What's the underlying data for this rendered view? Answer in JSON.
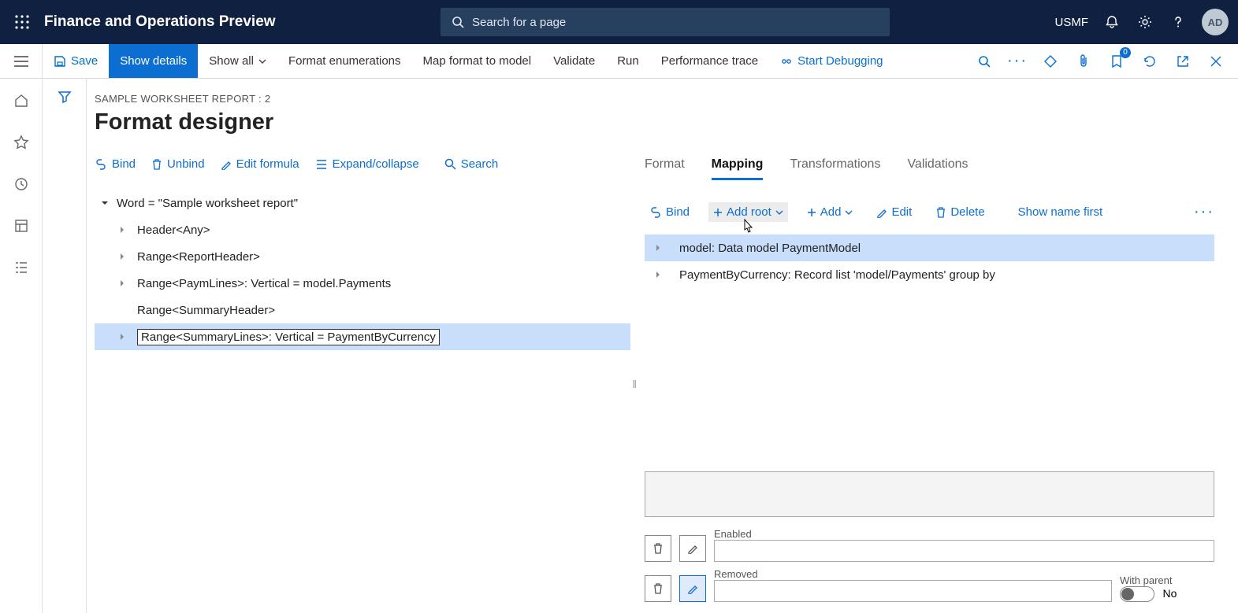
{
  "header": {
    "app_title": "Finance and Operations Preview",
    "search_placeholder": "Search for a page",
    "entity": "USMF",
    "avatar": "AD"
  },
  "cmdbar": {
    "save": "Save",
    "show_details": "Show details",
    "show_all": "Show all",
    "format_enum": "Format enumerations",
    "map_format": "Map format to model",
    "validate": "Validate",
    "run": "Run",
    "perf_trace": "Performance trace",
    "start_debug": "Start Debugging",
    "badge_count": "0"
  },
  "page": {
    "breadcrumb": "SAMPLE WORKSHEET REPORT : 2",
    "title": "Format designer"
  },
  "left_toolbar": {
    "bind": "Bind",
    "unbind": "Unbind",
    "edit_formula": "Edit formula",
    "expand_collapse": "Expand/collapse",
    "search": "Search"
  },
  "format_tree": {
    "root": "Word = \"Sample worksheet report\"",
    "items": [
      "Header<Any>",
      "Range<ReportHeader>",
      "Range<PaymLines>: Vertical = model.Payments",
      "Range<SummaryHeader>",
      "Range<SummaryLines>: Vertical = PaymentByCurrency"
    ]
  },
  "tabs": {
    "format": "Format",
    "mapping": "Mapping",
    "transformations": "Transformations",
    "validations": "Validations"
  },
  "right_toolbar": {
    "bind": "Bind",
    "add_root": "Add root",
    "add": "Add",
    "edit": "Edit",
    "delete": "Delete",
    "show_name_first": "Show name first"
  },
  "mapping_tree": {
    "items": [
      "model: Data model PaymentModel",
      "PaymentByCurrency: Record list 'model/Payments' group by"
    ]
  },
  "fields": {
    "enabled_label": "Enabled",
    "removed_label": "Removed",
    "with_parent_label": "With parent",
    "with_parent_value": "No"
  }
}
